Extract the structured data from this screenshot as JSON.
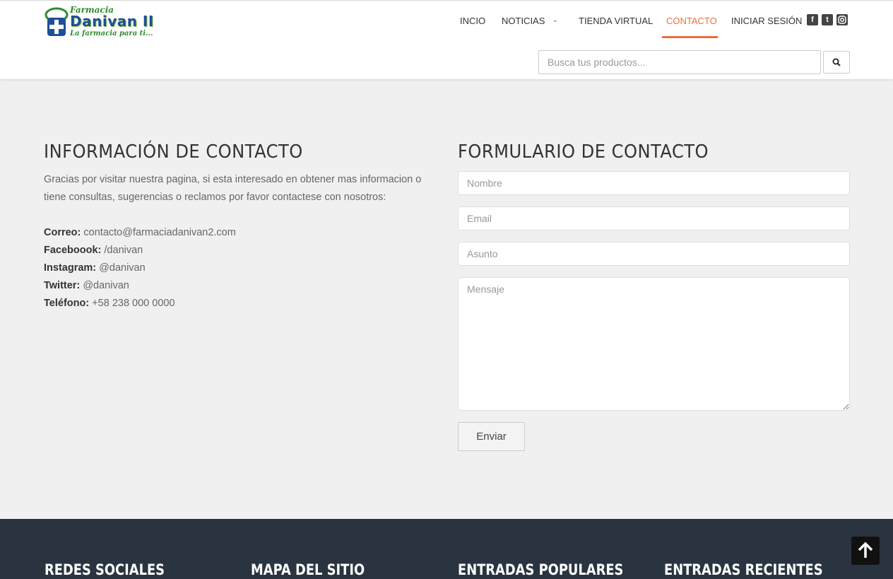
{
  "header": {
    "logo": {
      "line1": "Farmacia",
      "line2": "Danivan II",
      "line3": "La farmacia para ti..."
    },
    "nav": [
      {
        "label": "INCIO"
      },
      {
        "label": "NOTICIAS"
      },
      {
        "label": "TIENDA VIRTUAL"
      },
      {
        "label": "CONTACTO",
        "active": true
      },
      {
        "label": "INICIAR SESIÓN"
      }
    ],
    "social_icons": [
      "facebook-icon",
      "twitter-icon",
      "instagram-icon"
    ],
    "search": {
      "placeholder": "Busca tus productos..."
    }
  },
  "contact_info": {
    "title": "INFORMACIÓN DE CONTACTO",
    "intro": "Gracias por visitar nuestra pagina, si esta interesado en obtener mas informacion o tiene consultas, sugerencias o reclamos por favor contactese con nosotros:",
    "items": [
      {
        "label": "Correo:",
        "value": "contacto@farmaciadanivan2.com"
      },
      {
        "label": "Faceboook:",
        "value": "/danivan"
      },
      {
        "label": "Instagram:",
        "value": "@danivan"
      },
      {
        "label": "Twitter:",
        "value": "@danivan"
      },
      {
        "label": "Teléfono:",
        "value": "+58 238 000 0000"
      }
    ]
  },
  "contact_form": {
    "title": "FORMULARIO DE CONTACTO",
    "name_placeholder": "Nombre",
    "email_placeholder": "Email",
    "subject_placeholder": "Asunto",
    "message_placeholder": "Mensaje",
    "submit_label": "Enviar"
  },
  "footer": {
    "columns": [
      {
        "title": "REDES SOCIALES"
      },
      {
        "title": "MAPA DEL SITIO"
      },
      {
        "title": "ENTRADAS POPULARES"
      },
      {
        "title": "ENTRADAS RECIENTES"
      }
    ]
  },
  "colors": {
    "accent": "#e8703f",
    "footer_bg": "#2a3440",
    "page_bg": "#f0f0f0"
  }
}
